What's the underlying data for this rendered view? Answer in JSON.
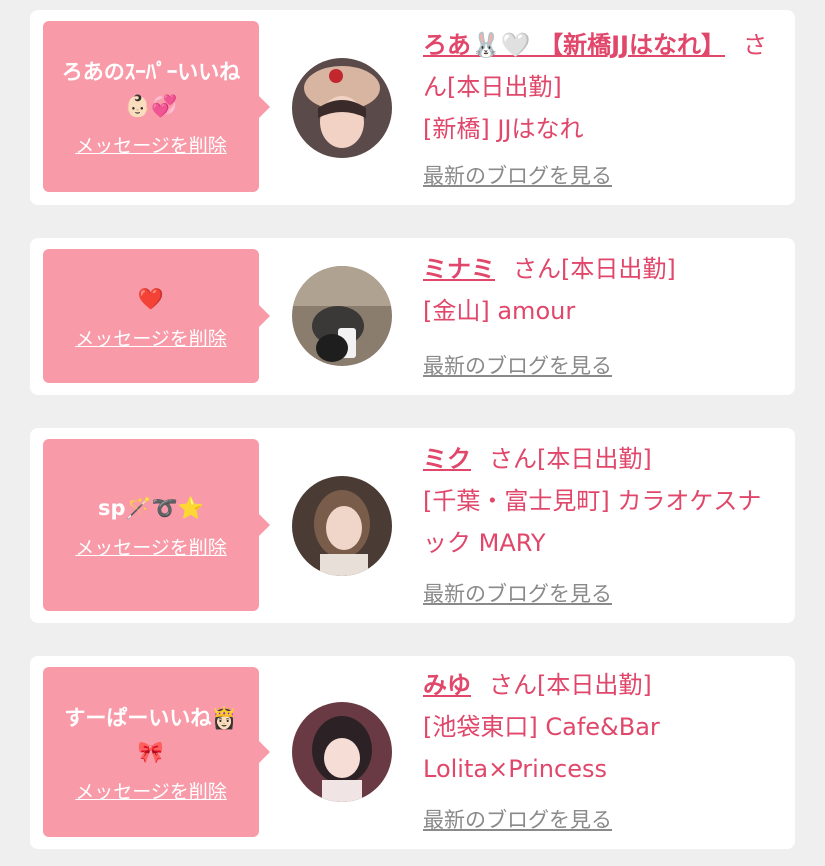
{
  "cards": [
    {
      "message": "ろあのｽｰﾊﾟｰいいね👶🏻💞",
      "delete_label": "メッセージを削除",
      "name": "ろあ🐰🤍 【新橋JJはなれ】",
      "san_status": "さん[本日出勤]",
      "area_shop": "[新橋] JJはなれ",
      "blog_link": "最新のブログを見る",
      "avatar_icon": "user-photo-icon"
    },
    {
      "message": "❤️",
      "delete_label": "メッセージを削除",
      "name": "ミナミ",
      "san_status": "さん[本日出勤]",
      "area_shop": "[金山] amour",
      "blog_link": "最新のブログを見る",
      "avatar_icon": "user-photo-icon"
    },
    {
      "message": "sp🪄➰⭐️",
      "delete_label": "メッセージを削除",
      "name": "ミク",
      "san_status": "さん[本日出勤]",
      "area_shop": "[千葉・富士見町] カラオケスナック MARY",
      "blog_link": "最新のブログを見る",
      "avatar_icon": "user-photo-icon"
    },
    {
      "message": "すーぱーいいね👸🏻🎀",
      "delete_label": "メッセージを削除",
      "name": "みゆ",
      "san_status": "さん[本日出勤]",
      "area_shop": "[池袋東口] Cafe&Bar Lolita×Princess",
      "blog_link": "最新のブログを見る",
      "avatar_icon": "user-photo-icon"
    }
  ],
  "colors": {
    "background": "#efefef",
    "bubble": "#f89aa8",
    "accent": "#e0476a",
    "link_gray": "#8a8a8a"
  }
}
